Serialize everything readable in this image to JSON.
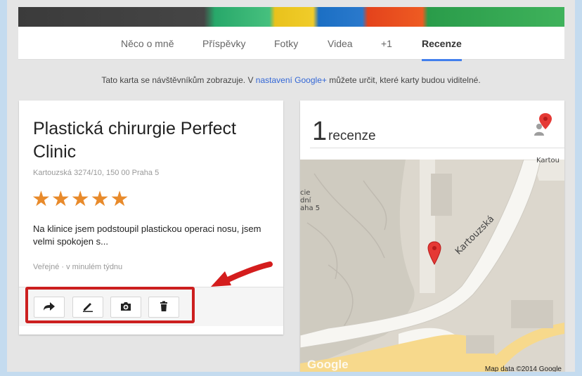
{
  "nav": {
    "tabs": [
      {
        "label": "Něco o mně"
      },
      {
        "label": "Příspěvky"
      },
      {
        "label": "Fotky"
      },
      {
        "label": "Videa"
      },
      {
        "label": "+1"
      },
      {
        "label": "Recenze"
      }
    ],
    "active_tab": "Recenze"
  },
  "notice": {
    "before": "Tato karta se návštěvníkům zobrazuje. V ",
    "link": "nastavení Google+",
    "after": " můžete určit, které karty budou viditelné."
  },
  "review": {
    "place_name": "Plastická chirurgie Perfect Clinic",
    "address": "Kartouzská 3274/10, 150 00 Praha 5",
    "stars": "★★★★★",
    "rating": 5,
    "text": "Na klinice jsem podstoupil plastickou operaci nosu, jsem velmi spokojen s...",
    "meta": "Veřejné · v minulém týdnu",
    "actions": [
      "share-icon",
      "edit-icon",
      "add-photo-icon",
      "delete-icon"
    ]
  },
  "reviews_summary": {
    "count": "1",
    "label": "recenze"
  },
  "map": {
    "street_label": "Kartouzská",
    "street_label_top": "Kartou",
    "place_fragment": "cie\ndní\naha 5",
    "copyright": "Map data ©2014 Google",
    "logo": "Google"
  },
  "colors": {
    "accent": "#427fed",
    "stars": "#e88a2b",
    "highlight": "#cc1f1f",
    "link": "#3367d6"
  }
}
